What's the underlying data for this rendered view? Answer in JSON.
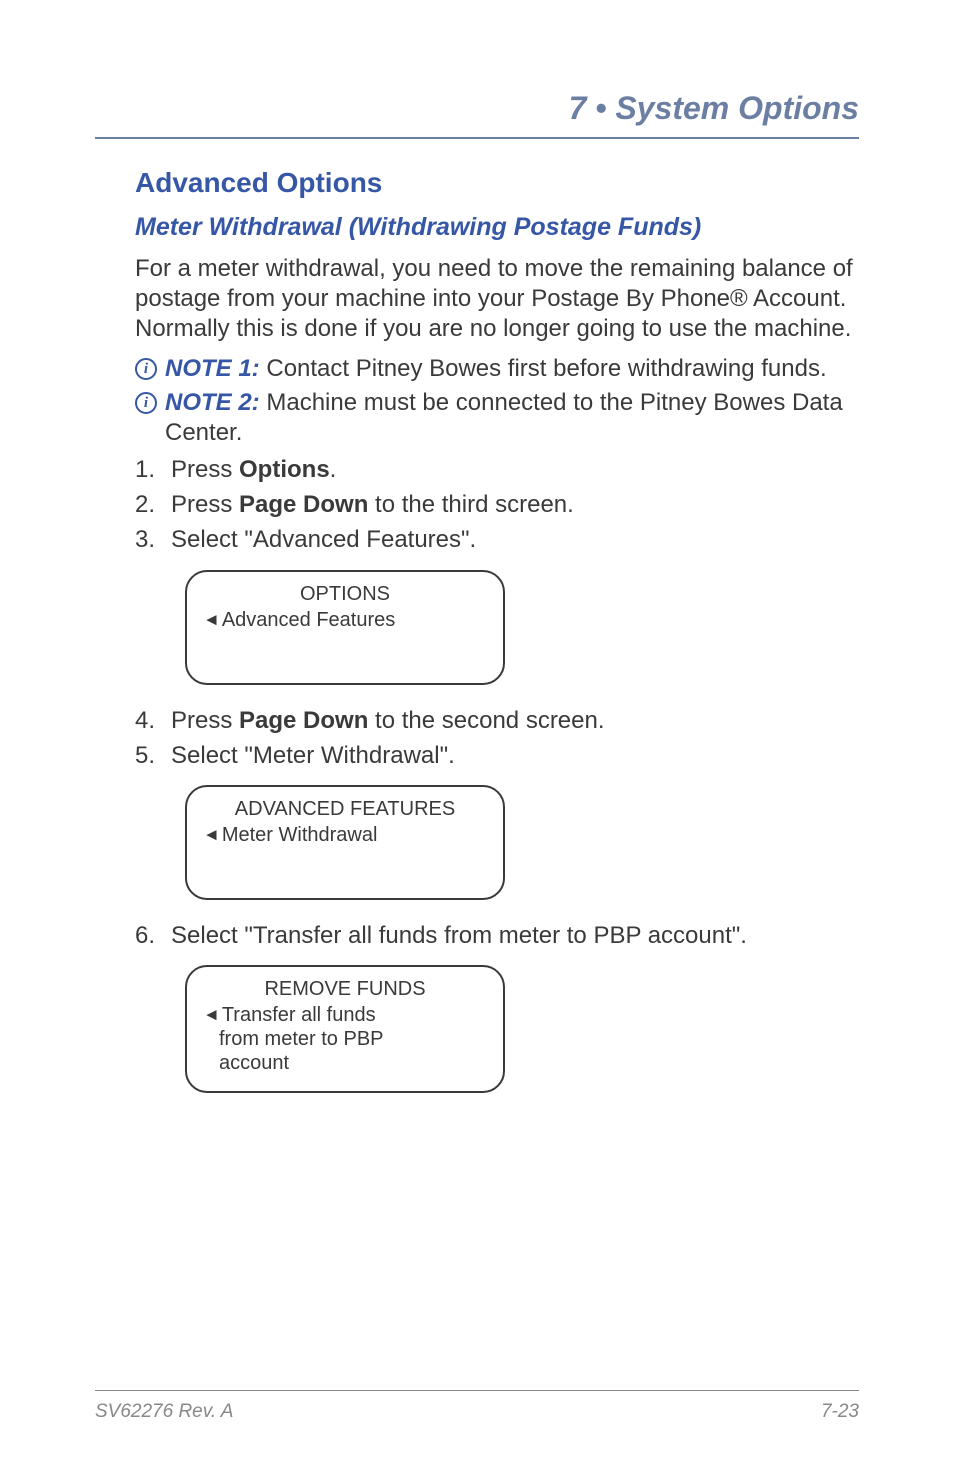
{
  "chapter": {
    "label": "7 • System Options"
  },
  "section_title": "Advanced Options",
  "subsection_title": "Meter Withdrawal (Withdrawing Postage Funds)",
  "intro_paragraph": "For a meter withdrawal, you need to move the remaining balance of postage from your machine into your Postage By Phone® Account. Normally this is done if you are no longer going to use the machine.",
  "notes": [
    {
      "label": "NOTE 1:",
      "text": " Contact Pitney Bowes first before withdrawing funds."
    },
    {
      "label": "NOTE 2:",
      "text": " Machine must be connected to the Pitney Bowes Data Center."
    }
  ],
  "steps": [
    {
      "num": "1.",
      "prefix": "Press ",
      "bold": "Options",
      "suffix": "."
    },
    {
      "num": "2.",
      "prefix": "Press ",
      "bold": "Page Down",
      "suffix": " to the third screen."
    },
    {
      "num": "3.",
      "prefix": "Select \"Advanced Features\".",
      "bold": "",
      "suffix": ""
    },
    {
      "num": "4.",
      "prefix": "Press ",
      "bold": "Page Down",
      "suffix": " to the second screen."
    },
    {
      "num": "5.",
      "prefix": "Select \"Meter Withdrawal\".",
      "bold": "",
      "suffix": ""
    },
    {
      "num": "6.",
      "prefix": "Select \"Transfer all funds from meter to PBP account\".",
      "bold": "",
      "suffix": ""
    }
  ],
  "lcd": {
    "box1": {
      "title": "OPTIONS",
      "line1": "Advanced Features"
    },
    "box2": {
      "title": "ADVANCED FEATURES",
      "line1": "Meter Withdrawal"
    },
    "box3": {
      "title": "REMOVE FUNDS",
      "line1": "Transfer all funds",
      "line2": "from meter to PBP",
      "line3": "account"
    }
  },
  "footer": {
    "left": "SV62276 Rev. A",
    "right": "7-23"
  }
}
